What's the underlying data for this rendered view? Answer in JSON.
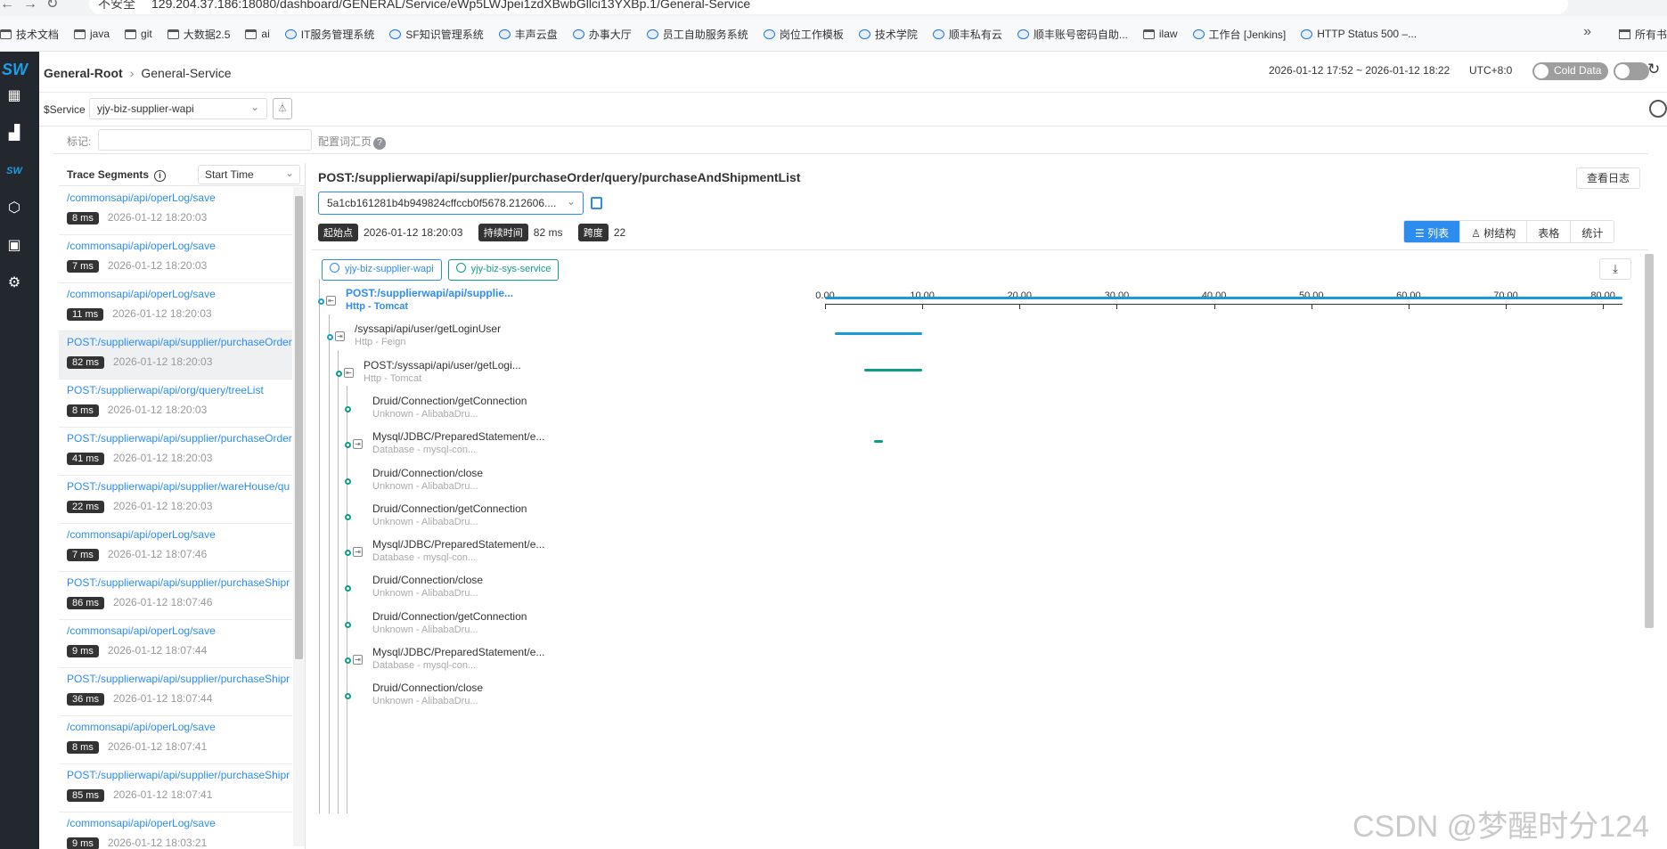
{
  "browser": {
    "security_warning": "不安全",
    "url": "129.204.37.186:18080/dashboard/GENERAL/Service/eWp5LWJpei1zdXBwbGllci13YXBp.1/General-Service"
  },
  "bookmarks": [
    "技术文档",
    "java",
    "git",
    "大数据2.5",
    "ai",
    "IT服务管理系统",
    "SF知识管理系统",
    "丰声云盘",
    "办事大厅",
    "员工自助服务系统",
    "岗位工作模板",
    "技术学院",
    "顺丰私有云",
    "顺丰账号密码自助...",
    "ilaw",
    "工作台 [Jenkins]",
    "HTTP Status 500 –..."
  ],
  "bookmarks_all": "所有书",
  "header": {
    "root_crumb": "General-Root",
    "service_crumb": "General-Service",
    "time_range": "2026-01-12 17:52 ~ 2026-01-12 18:22",
    "utc": "UTC+8:0",
    "cold_data": "Cold Data"
  },
  "service_bar": {
    "label": "$Service",
    "selected": "yjy-biz-supplier-wapi"
  },
  "marks": {
    "label": "标记:",
    "vocab_link": "配置词汇页"
  },
  "segments_panel": {
    "title": "Trace Segments",
    "sort": "Start Time",
    "items": [
      {
        "endpoint": "/commonsapi/api/operLog/save",
        "duration": "8 ms",
        "time": "2026-01-12 18:20:03"
      },
      {
        "endpoint": "/commonsapi/api/operLog/save",
        "duration": "7 ms",
        "time": "2026-01-12 18:20:03"
      },
      {
        "endpoint": "/commonsapi/api/operLog/save",
        "duration": "11 ms",
        "time": "2026-01-12 18:20:03"
      },
      {
        "endpoint": "POST:/supplierwapi/api/supplier/purchaseOrder",
        "duration": "82 ms",
        "time": "2026-01-12 18:20:03"
      },
      {
        "endpoint": "POST:/supplierwapi/api/org/query/treeList",
        "duration": "8 ms",
        "time": "2026-01-12 18:20:03"
      },
      {
        "endpoint": "POST:/supplierwapi/api/supplier/purchaseOrder",
        "duration": "41 ms",
        "time": "2026-01-12 18:20:03"
      },
      {
        "endpoint": "POST:/supplierwapi/api/supplier/wareHouse/qu",
        "duration": "22 ms",
        "time": "2026-01-12 18:20:03"
      },
      {
        "endpoint": "/commonsapi/api/operLog/save",
        "duration": "7 ms",
        "time": "2026-01-12 18:07:46"
      },
      {
        "endpoint": "POST:/supplierwapi/api/supplier/purchaseShipr",
        "duration": "86 ms",
        "time": "2026-01-12 18:07:46"
      },
      {
        "endpoint": "/commonsapi/api/operLog/save",
        "duration": "9 ms",
        "time": "2026-01-12 18:07:44"
      },
      {
        "endpoint": "POST:/supplierwapi/api/supplier/purchaseShipr",
        "duration": "36 ms",
        "time": "2026-01-12 18:07:44"
      },
      {
        "endpoint": "/commonsapi/api/operLog/save",
        "duration": "8 ms",
        "time": "2026-01-12 18:07:41"
      },
      {
        "endpoint": "POST:/supplierwapi/api/supplier/purchaseShipr",
        "duration": "85 ms",
        "time": "2026-01-12 18:07:41"
      },
      {
        "endpoint": "/commonsapi/api/operLog/save",
        "duration": "9 ms",
        "time": "2026-01-12 18:03:21"
      }
    ]
  },
  "detail": {
    "endpoint": "POST:/supplierwapi/api/supplier/purchaseOrder/query/purchaseAndShipmentList",
    "view_log": "查看日志",
    "trace_id": "5a1cb161281b4b949824cffccb0f5678.212606....",
    "start_label": "起始点",
    "start_value": "2026-01-12 18:20:03",
    "duration_label": "持续时间",
    "duration_value": "82 ms",
    "span_label": "跨度",
    "span_value": "22",
    "views": [
      "列表",
      "树结构",
      "表格",
      "统计"
    ],
    "services": [
      "yjy-biz-supplier-wapi",
      "yjy-biz-sys-service"
    ]
  },
  "timeline": {
    "ticks": [
      "0.00",
      "10.00",
      "20.00",
      "30.00",
      "40.00",
      "50.00",
      "60.00",
      "70.00",
      "80.00"
    ],
    "max": 82,
    "spans": [
      {
        "name": "POST:/supplierwapi/api/supplie...",
        "sub": "Http - Tomcat",
        "level": 0,
        "root": true,
        "dot": "b",
        "box": "in",
        "start": 0,
        "end": 82,
        "color": "#1a9bd7"
      },
      {
        "name": "/syssapi/api/user/getLoginUser",
        "sub": "Http - Feign",
        "level": 1,
        "dot": "b",
        "box": "out",
        "start": 1,
        "end": 10,
        "color": "#1a9bd7"
      },
      {
        "name": "POST:/syssapi/api/user/getLogi...",
        "sub": "Http - Tomcat",
        "level": 2,
        "dot": "g",
        "box": "in",
        "start": 4,
        "end": 10,
        "color": "#0f9d8b"
      },
      {
        "name": "Druid/Connection/getConnection",
        "sub": "Unknown - AlibabaDru...",
        "level": 3,
        "dot": "g"
      },
      {
        "name": "Mysql/JDBC/PreparedStatement/e...",
        "sub": "Database - mysql-con...",
        "level": 3,
        "dot": "g",
        "box": "out",
        "start": 5,
        "end": 6,
        "color": "#0f9d8b"
      },
      {
        "name": "Druid/Connection/close",
        "sub": "Unknown - AlibabaDru...",
        "level": 3,
        "dot": "g"
      },
      {
        "name": "Druid/Connection/getConnection",
        "sub": "Unknown - AlibabaDru...",
        "level": 3,
        "dot": "g"
      },
      {
        "name": "Mysql/JDBC/PreparedStatement/e...",
        "sub": "Database - mysql-con...",
        "level": 3,
        "dot": "g",
        "box": "out"
      },
      {
        "name": "Druid/Connection/close",
        "sub": "Unknown - AlibabaDru...",
        "level": 3,
        "dot": "g"
      },
      {
        "name": "Druid/Connection/getConnection",
        "sub": "Unknown - AlibabaDru...",
        "level": 3,
        "dot": "g"
      },
      {
        "name": "Mysql/JDBC/PreparedStatement/e...",
        "sub": "Database - mysql-con...",
        "level": 3,
        "dot": "g",
        "box": "out"
      },
      {
        "name": "Druid/Connection/close",
        "sub": "Unknown - AlibabaDru...",
        "level": 3,
        "dot": "g"
      }
    ]
  },
  "watermark": "CSDN @梦醒时分124"
}
